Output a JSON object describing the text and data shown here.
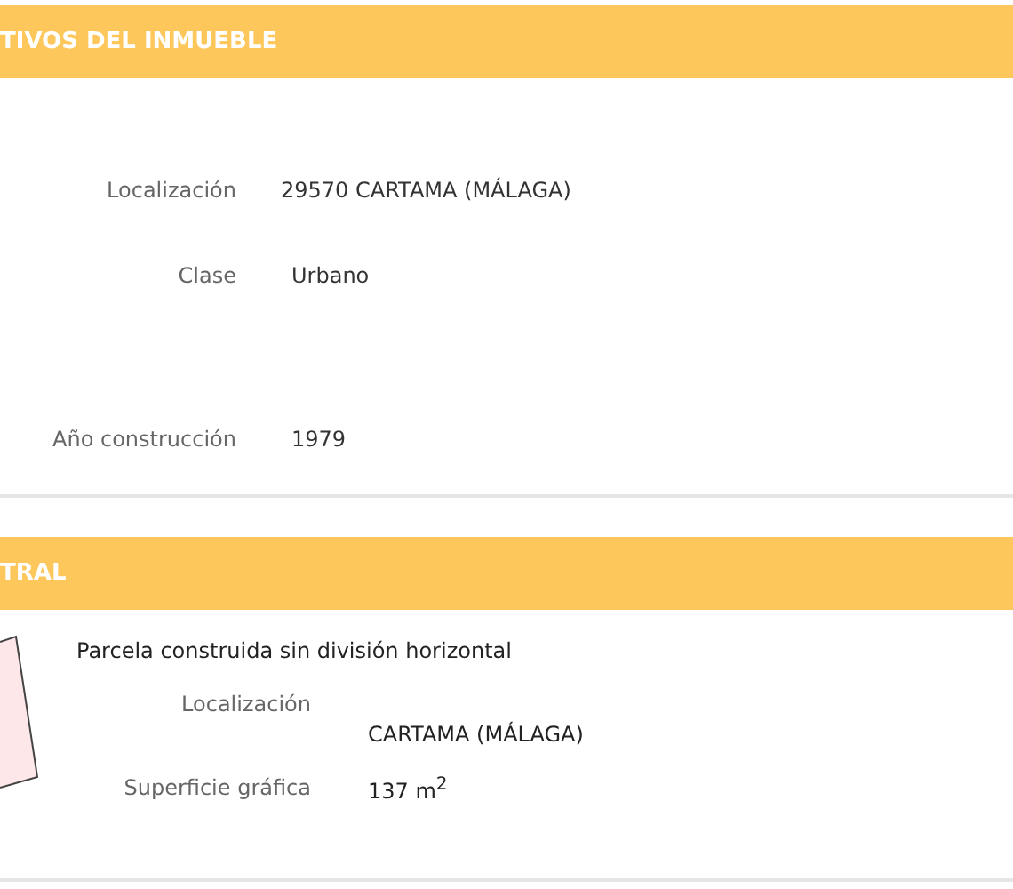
{
  "sections": [
    {
      "title": "TIVOS DEL INMUEBLE",
      "rows": [
        {
          "label": "Localización",
          "value": "29570 CARTAMA (MÁLAGA)"
        },
        {
          "label": "Clase",
          "value": "Urbano"
        },
        {
          "label": "Año construcción",
          "value": "1979"
        }
      ]
    },
    {
      "title": "TRAL",
      "description": "Parcela construida sin división horizontal",
      "rows": [
        {
          "label": "Localización",
          "value": "CARTAMA (MÁLAGA)"
        },
        {
          "label": "Superficie gráfica",
          "value": "137 m$^{2}$"
        }
      ]
    }
  ]
}
